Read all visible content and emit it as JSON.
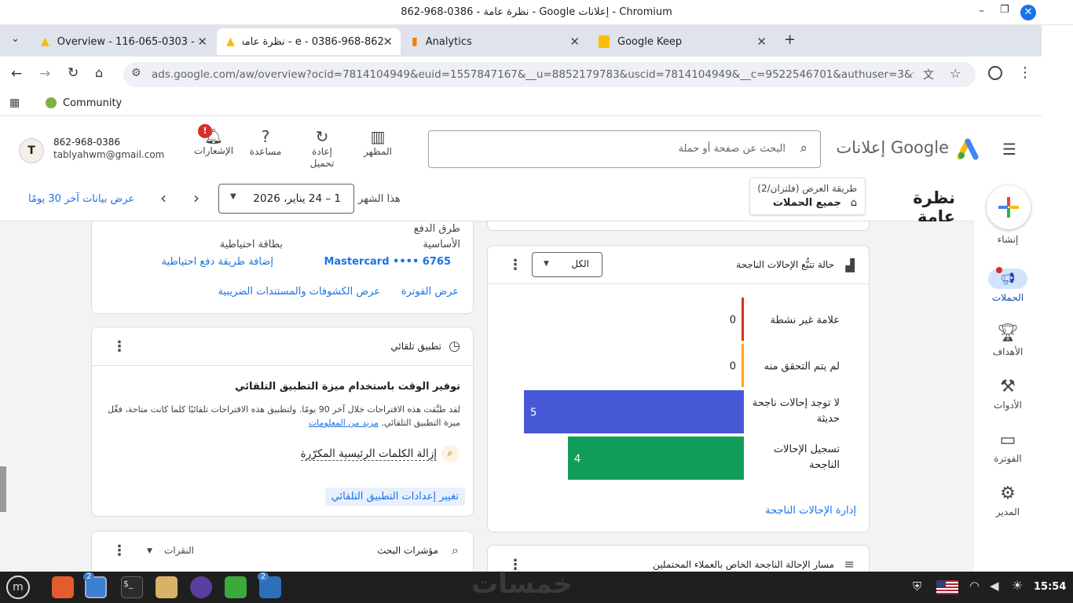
{
  "window": {
    "title": "نظرة عامة - 0386-968-862 - Google إعلانات - Chromium"
  },
  "tabs": [
    {
      "label": "Overview - 116-065-0303 - Go"
    },
    {
      "label": "e - 0386-968-862 - نظرة عامة"
    },
    {
      "label": "Analytics"
    },
    {
      "label": "Google Keep"
    }
  ],
  "address": {
    "url": "ads.google.com/aw/overview?ocid=7814104949&euid=1557847167&__u=8852179783&uscid=7814104949&__c=9522546701&authuser=3&workspaceI..."
  },
  "bookmarks": [
    {
      "label": "Community"
    }
  ],
  "header": {
    "brand": "Google إعلانات",
    "search_placeholder": "البحث عن صفحة أو حملة",
    "tools": [
      {
        "label": "المظهر"
      },
      {
        "label": "إعادة تحميل"
      },
      {
        "label": "مساعدة"
      },
      {
        "label": "الإشعارات"
      }
    ],
    "account_phone": "862-968-0386",
    "account_email": "tablyahwm@gmail.com",
    "notification_badge": "!"
  },
  "subheader": {
    "page_title": "نظرة عامة",
    "view_mode": "طريقة العرض (فلتزان/2)",
    "campaign_scope": "جميع الحملات",
    "this_month": "هذا الشهر",
    "date_range": "1 – 24 يناير، 2026",
    "last30": "عرض بيانات آخر 30 يومًا"
  },
  "rail": [
    {
      "label": "إنشاء"
    },
    {
      "label": "الحملات"
    },
    {
      "label": "الأهداف"
    },
    {
      "label": "الأدوات"
    },
    {
      "label": "الفوترة"
    },
    {
      "label": "المدير"
    }
  ],
  "billing_card": {
    "payment_methods": "طرق الدفع",
    "primary": "الأساسية",
    "backup": "بطاقة احتياطية",
    "card_number": "Mastercard •••• 6765",
    "add_backup": "إضافة طريقة دفع احتياطية",
    "view_invoice": "عرض الفوترة",
    "view_statements": "عرض الكشوفات والمستندات الضريبية"
  },
  "auto_apply_card": {
    "title": "تطبيق تلقائي",
    "heading": "توفير الوقت باستخدام ميزة التطبيق التلقائي",
    "body": "لقد طبَّقت هذه الاقتراحات خلال آخر 90 يومًا. ولتطبيق هذه الاقتراحات تلقائيًا كلما كانت متاحة، فعِّل ميزة التطبيق التلقائي.",
    "learn_more": "مزيد من المعلومات",
    "suggestion": "إزالة الكلمات الرئيسية المكرّرة",
    "change_settings": "تغيير إعدادات التطبيق التلقائي"
  },
  "search_insights_card": {
    "title": "مؤشرات البحث",
    "metric": "النقرات"
  },
  "conversion_card": {
    "title": "حالة تتبُّع الإحالات الناجحة",
    "filter": "الكل",
    "manage_link": "إدارة الإحالات الناجحة",
    "colors": {
      "inactive": "#d93025",
      "unverified": "#f9ab00",
      "no_recent": "#4758d6",
      "recording": "#0f9d58"
    }
  },
  "chart_data": {
    "type": "bar",
    "categories": [
      "علامة غير نشطة",
      "لم يتم التحقق منه",
      "لا توجد إحالات ناجحة حديثة",
      "تسجيل الإحالات الناجحة"
    ],
    "values": [
      0,
      0,
      5,
      4
    ],
    "orientation": "horizontal"
  },
  "funnel_card": {
    "title": "مسار الإحالة الناجحة الخاص بالعملاء المحتملين"
  },
  "taskbar": {
    "clock": "15:54",
    "badge_browser": "2",
    "badge_screenshot": "2"
  },
  "watermark": "خمسات"
}
